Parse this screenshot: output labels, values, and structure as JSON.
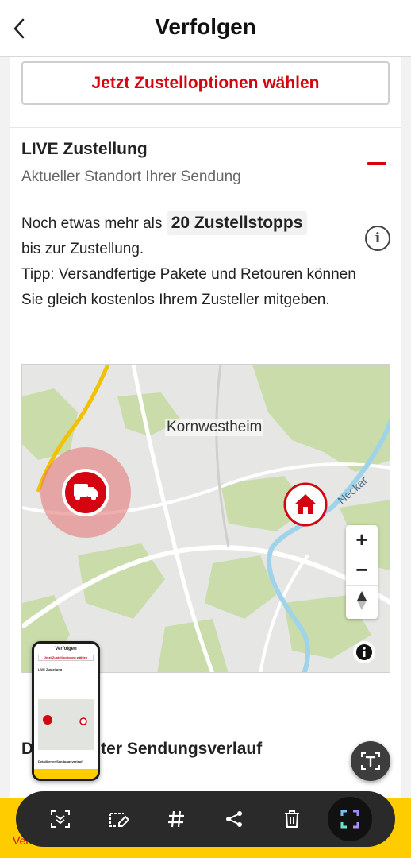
{
  "header": {
    "title": "Verfolgen"
  },
  "cta": {
    "label": "Jetzt Zustelloptionen wählen"
  },
  "live": {
    "title": "LIVE Zustellung",
    "subtitle": "Aktueller Standort Ihrer Sendung",
    "text_before": "Noch etwas mehr als",
    "stops": "20 Zustellstopps",
    "text_after": "bis zur Zustellung.",
    "tip_label": "Tipp:",
    "tip_text": "Versandfertige Pakete und Retouren können Sie gleich kostenlos Ihrem Zusteller mitgeben."
  },
  "map": {
    "city_label": "Kornwestheim",
    "river_label": "Neckar",
    "zoom_in": "+",
    "zoom_out": "−"
  },
  "verlauf": {
    "title_visible_part": "ter Sendungsverlauf",
    "title_prefix": "D"
  },
  "bottom_nav": {
    "left_label": "Verfo"
  },
  "thumbnail": {
    "title": "Verfolgen",
    "cta": "Jetzt Zustelloptionen wählen",
    "live": "LIVE Zustellung",
    "verlauf": "Detaillierter Sendungsverlauf"
  },
  "colors": {
    "brand_red": "#d40511",
    "brand_yellow": "#ffcc00",
    "toolbar_bg": "#2a2a2a"
  },
  "toolbar_icons": [
    "scan-icon",
    "edit-selection-icon",
    "hashtag-icon",
    "share-icon",
    "delete-icon",
    "crop-icon"
  ]
}
